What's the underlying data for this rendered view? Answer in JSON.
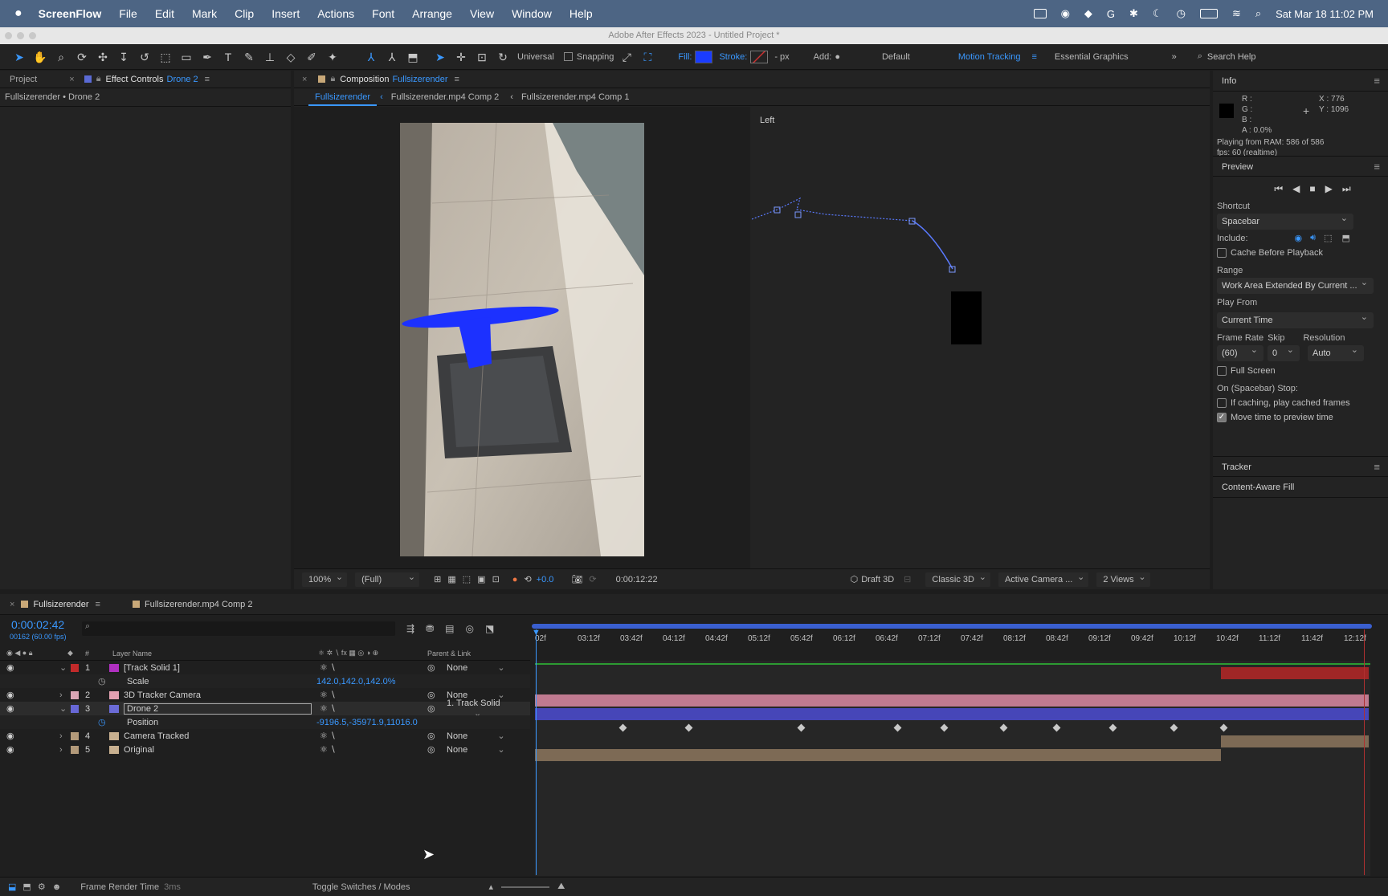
{
  "menubar": {
    "app": "ScreenFlow",
    "items": [
      "File",
      "Edit",
      "Mark",
      "Clip",
      "Insert",
      "Actions",
      "Font",
      "Arrange",
      "View",
      "Window",
      "Help"
    ],
    "datetime": "Sat Mar 18  11:02 PM"
  },
  "window": {
    "title": "Adobe After Effects 2023 - Untitled Project *"
  },
  "toolbar": {
    "universal": "Universal",
    "snapping": "Snapping",
    "fill": "Fill:",
    "stroke": "Stroke:",
    "px": "- px",
    "add": "Add:",
    "workspaces": [
      "Default",
      "Motion Tracking",
      "Essential Graphics"
    ],
    "active_workspace": "Motion Tracking",
    "search_placeholder": "Search Help",
    "fill_color": "#1a3cff"
  },
  "left_panel": {
    "tab_project": "Project",
    "tab_effect_controls": "Effect Controls",
    "effect_layer": "Drone 2",
    "breadcrumb": "Fullsizerender • Drone 2"
  },
  "comp_panel": {
    "tab_label": "Composition",
    "comp_name": "Fullsizerender",
    "crumbs": [
      "Fullsizerender",
      "Fullsizerender.mp4 Comp 2",
      "Fullsizerender.mp4 Comp 1"
    ],
    "left_view_label": "Left",
    "viewbar": {
      "zoom": "100%",
      "resolution": "(Full)",
      "exposure": "+0.0",
      "timecode": "0:00:12:22",
      "draft": "Draft 3D",
      "renderer": "Classic 3D",
      "camera": "Active Camera ...",
      "views": "2 Views"
    },
    "drone_color": "#1c31ff"
  },
  "info_panel": {
    "title": "Info",
    "r": "R :",
    "g": "G :",
    "b": "B :",
    "a": "A :  0.0%",
    "x": "X : 776",
    "y": "Y : 1096",
    "ram": "Playing from RAM: 586 of 586",
    "fps": "fps: 60 (realtime)"
  },
  "preview_panel": {
    "title": "Preview",
    "shortcut_label": "Shortcut",
    "shortcut_value": "Spacebar",
    "include_label": "Include:",
    "cache_label": "Cache Before Playback",
    "range_label": "Range",
    "range_value": "Work Area Extended By Current ...",
    "playfrom_label": "Play From",
    "playfrom_value": "Current Time",
    "framerate_label": "Frame Rate",
    "skip_label": "Skip",
    "resolution_label": "Resolution",
    "framerate_value": "(60)",
    "skip_value": "0",
    "resolution_value": "Auto",
    "fullscreen_label": "Full Screen",
    "onstop_label": "On (Spacebar) Stop:",
    "ifcaching_label": "If caching, play cached frames",
    "movetime_label": "Move time to preview time"
  },
  "tracker_panel": {
    "title": "Tracker",
    "content_aware": "Content-Aware Fill"
  },
  "timeline": {
    "tab_active": "Fullsizerender",
    "tab_other": "Fullsizerender.mp4 Comp 2",
    "timecode": "0:00:02:42",
    "frames": "00162 (60.00 fps)",
    "col_layer_name": "Layer Name",
    "col_parent": "Parent & Link",
    "ticks": [
      "02f",
      "03:12f",
      "03:42f",
      "04:12f",
      "04:42f",
      "05:12f",
      "05:42f",
      "06:12f",
      "06:42f",
      "07:12f",
      "07:42f",
      "08:12f",
      "08:42f",
      "09:12f",
      "09:42f",
      "10:12f",
      "10:42f",
      "11:12f",
      "11:42f",
      "12:12f"
    ],
    "layers": [
      {
        "num": "1",
        "name": "[Track Solid 1]",
        "color": "#b030c0",
        "label": "#c12a2a",
        "parent": "None"
      },
      {
        "num": "",
        "name": "Scale",
        "prop": true,
        "value": "142.0,142.0,142.0%"
      },
      {
        "num": "2",
        "name": "3D Tracker Camera",
        "color": "#e2a0b0",
        "label": "#d9a6b5",
        "parent": "None"
      },
      {
        "num": "3",
        "name": "Drone 2",
        "color": "#6b6bd6",
        "label": "#6868d6",
        "parent": "1. Track Solid"
      },
      {
        "num": "",
        "name": "Position",
        "prop": true,
        "value": "-9196.5,-35971.9,11016.0"
      },
      {
        "num": "4",
        "name": "Camera Tracked",
        "color": "#c8b090",
        "label": "#b39a7a",
        "parent": "None"
      },
      {
        "num": "5",
        "name": "Original",
        "color": "#c8b090",
        "label": "#b39a7a",
        "parent": "None"
      }
    ]
  },
  "statusbar": {
    "frame_render": "Frame Render Time",
    "render_ms": "3ms",
    "toggle": "Toggle Switches / Modes"
  }
}
